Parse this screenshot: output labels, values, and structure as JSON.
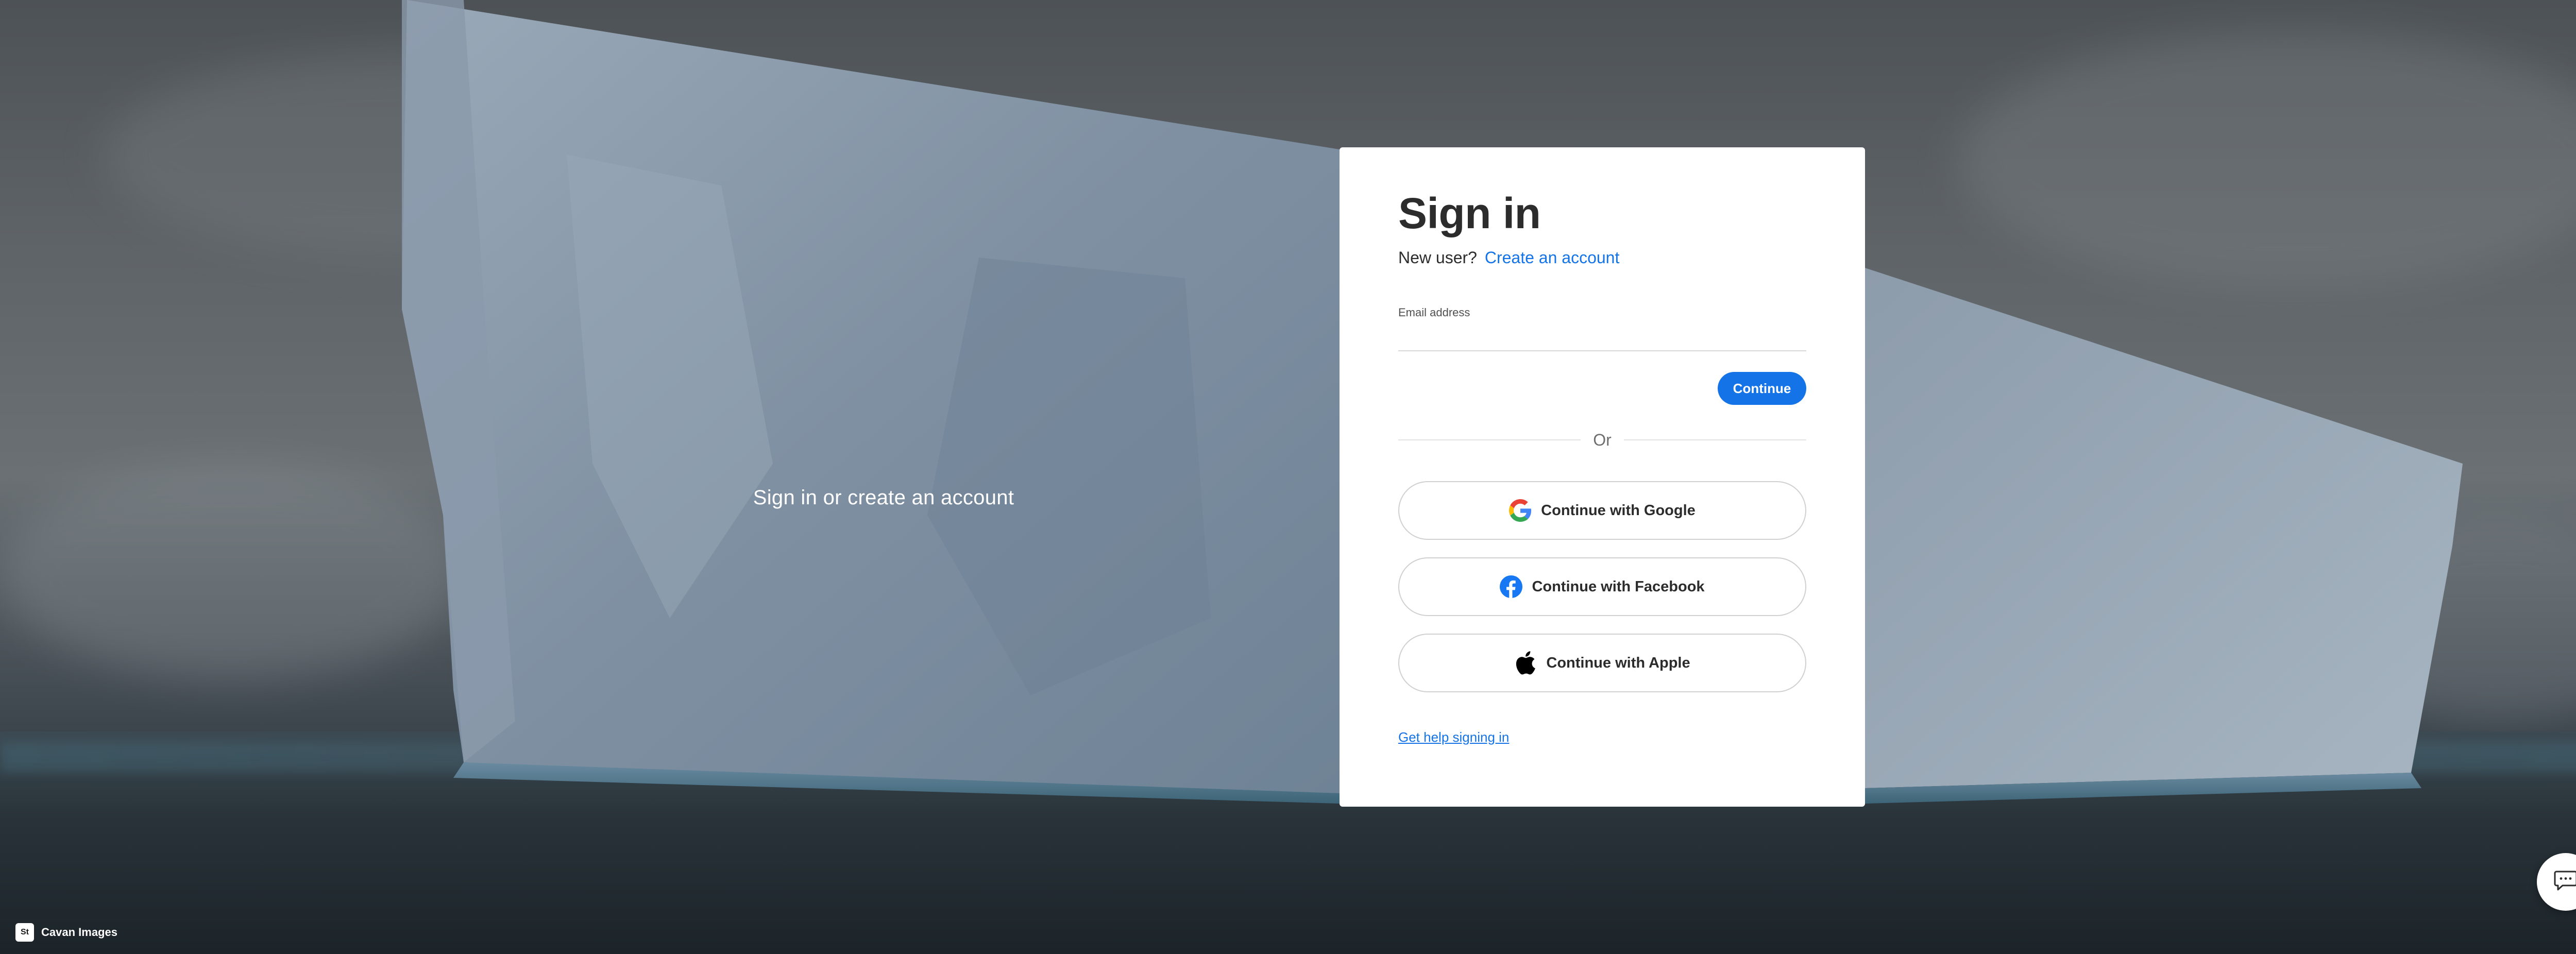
{
  "background": {
    "tagline": "Sign in or create an account",
    "photo_credit": "Cavan Images",
    "photo_credit_badge": "St"
  },
  "signin": {
    "title": "Sign in",
    "new_user_prompt": "New user?",
    "create_account_link": "Create an account",
    "email_label": "Email address",
    "email_value": "",
    "continue_label": "Continue",
    "or_label": "Or",
    "social": {
      "google_label": "Continue with Google",
      "facebook_label": "Continue with Facebook",
      "apple_label": "Continue with Apple"
    },
    "help_link": "Get help signing in"
  },
  "colors": {
    "accent": "#1473e6",
    "facebook": "#1877f2",
    "text": "#2c2c2c"
  },
  "icons": {
    "google": "google-icon",
    "facebook": "facebook-icon",
    "apple": "apple-icon",
    "chat": "chat-icon"
  }
}
